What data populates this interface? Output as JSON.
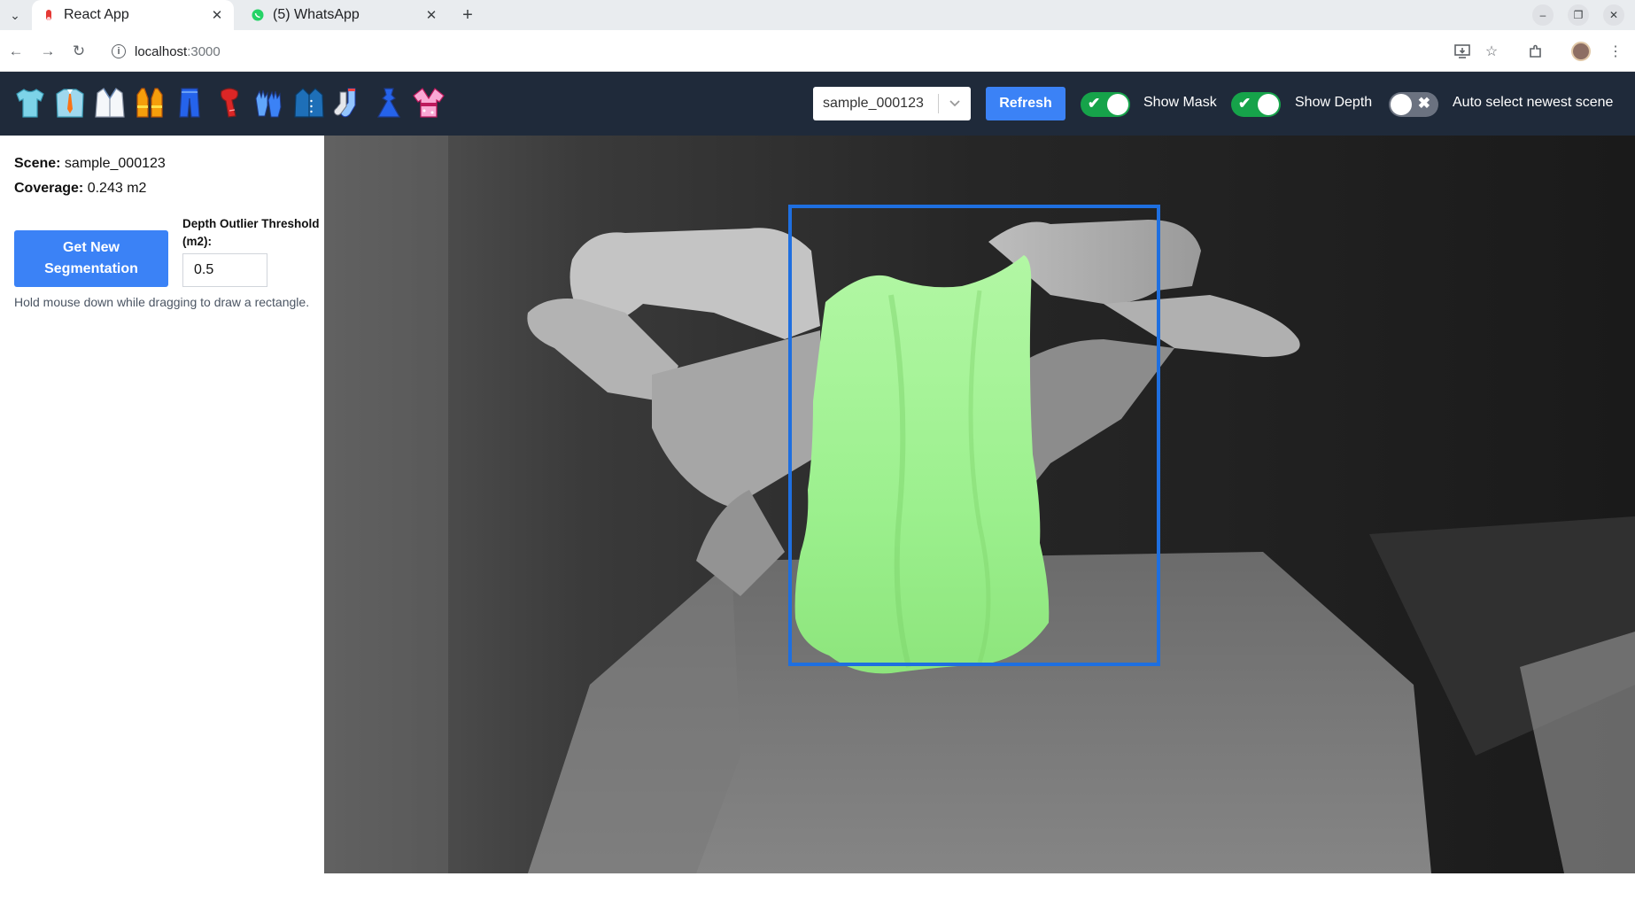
{
  "browser": {
    "tabs": [
      {
        "title": "React App",
        "active": true
      },
      {
        "title": "(5) WhatsApp",
        "active": false
      }
    ],
    "url": {
      "host": "localhost",
      "port": ":3000"
    }
  },
  "header": {
    "garment_icons": [
      "t-shirt-icon",
      "dress-shirt-icon",
      "lab-coat-icon",
      "safety-vest-icon",
      "jeans-icon",
      "scarf-icon",
      "gloves-icon",
      "coat-icon",
      "socks-icon",
      "dress-icon",
      "kimono-icon"
    ],
    "scene_select": {
      "value": "sample_000123"
    },
    "refresh_label": "Refresh",
    "toggles": [
      {
        "label": "Show Mask",
        "on": true
      },
      {
        "label": "Show Depth",
        "on": true
      },
      {
        "label": "Auto select newest scene",
        "on": false
      }
    ]
  },
  "panel": {
    "scene_label": "Scene:",
    "scene_value": "sample_000123",
    "coverage_label": "Coverage:",
    "coverage_value": "0.243 m2",
    "segment_button": "Get New Segmentation",
    "threshold_label": "Depth Outlier Threshold (m2):",
    "threshold_value": "0.5",
    "hint": "Hold mouse down while dragging to draw a rectangle."
  },
  "colors": {
    "header_bg": "#1f2a3a",
    "accent_blue": "#3b82f6",
    "toggle_on": "#16a34a",
    "toggle_off": "#6b7280",
    "mask_green": "#9cf08e",
    "bbox_blue": "#1e6fe0"
  }
}
